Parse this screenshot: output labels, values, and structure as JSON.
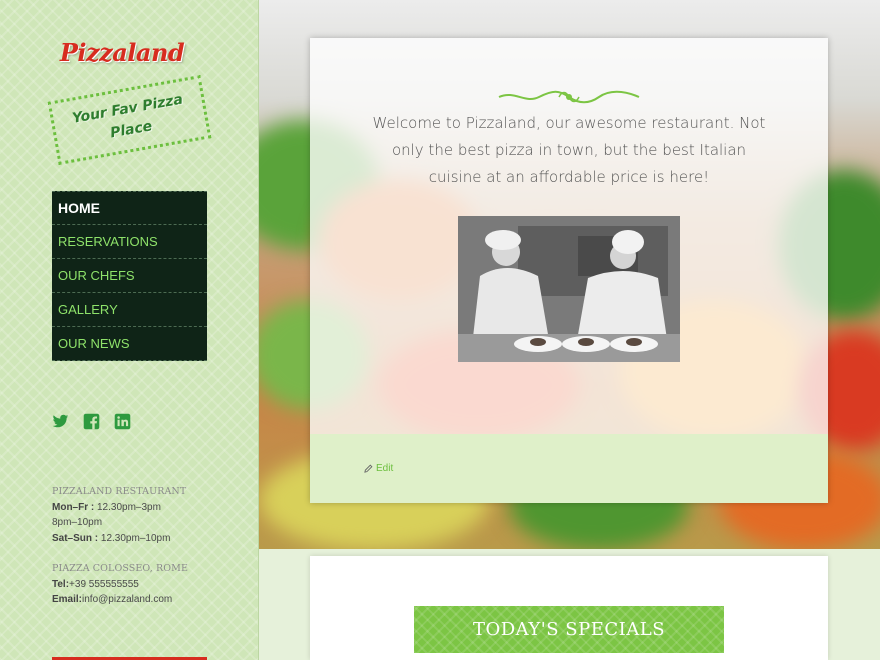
{
  "brand": {
    "name": "Pizzaland",
    "tagline": "Your Fav Pizza Place"
  },
  "nav": {
    "items": [
      {
        "label": "HOME",
        "active": true
      },
      {
        "label": "RESERVATIONS",
        "active": false
      },
      {
        "label": "OUR CHEFS",
        "active": false
      },
      {
        "label": "GALLERY",
        "active": false
      },
      {
        "label": "OUR NEWS",
        "active": false
      }
    ]
  },
  "social": [
    "twitter-icon",
    "facebook-icon",
    "linkedin-icon"
  ],
  "info": {
    "restaurant_name": "PIZZALAND RESTAURANT",
    "hours_weekday_label": "Mon–Fr :",
    "hours_weekday_1": "12.30pm–3pm",
    "hours_weekday_2": "8pm–10pm",
    "hours_weekend_label": "Sat–Sun :",
    "hours_weekend": "12.30pm–10pm",
    "address": "PIAZZA COLOSSEO, ROME",
    "tel_label": "Tel:",
    "tel": "+39 555555555",
    "email_label": "Email:",
    "email": "info@pizzaland.com"
  },
  "main": {
    "welcome_text": "Welcome to Pizzaland, our awesome restaurant. Not only the best pizza in town, but the best Italian cuisine at an af­fordable price is here!",
    "edit_label": "Edit"
  },
  "specials": {
    "title": "TODAY'S SPECIALS"
  },
  "colors": {
    "brand_red": "#d72c1f",
    "accent_green": "#6cbf3e",
    "nav_bg": "#0f2417",
    "nav_text": "#8ee26a"
  }
}
